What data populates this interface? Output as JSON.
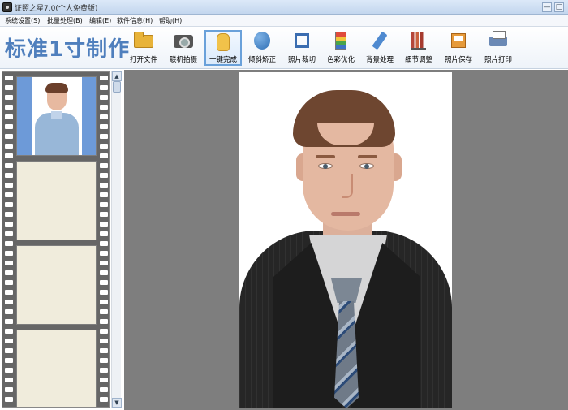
{
  "window": {
    "title": "证照之星7.0(个人免费版)",
    "minimize": "—",
    "close": "□"
  },
  "menu": [
    {
      "label": "系统设置(S)"
    },
    {
      "label": "批量处理(B)"
    },
    {
      "label": "编辑(E)"
    },
    {
      "label": "软件信息(H)"
    },
    {
      "label": "帮助(H)"
    }
  ],
  "toolbar": {
    "page_title": "标准1寸制作",
    "tools": [
      {
        "label": "打开文件",
        "icon": "folder-icon"
      },
      {
        "label": "联机拍摄",
        "icon": "camera-icon"
      },
      {
        "label": "一键完成",
        "icon": "hand-icon",
        "active": true
      },
      {
        "label": "倾斜矫正",
        "icon": "rotate-icon"
      },
      {
        "label": "照片裁切",
        "icon": "crop-icon"
      },
      {
        "label": "色彩优化",
        "icon": "color-icon"
      },
      {
        "label": "背景处理",
        "icon": "brush-icon"
      },
      {
        "label": "细节调整",
        "icon": "bars-icon"
      },
      {
        "label": "照片保存",
        "icon": "save-icon"
      },
      {
        "label": "照片打印",
        "icon": "printer-icon"
      }
    ]
  },
  "scrollbar": {
    "up": "▲",
    "down": "▼"
  }
}
